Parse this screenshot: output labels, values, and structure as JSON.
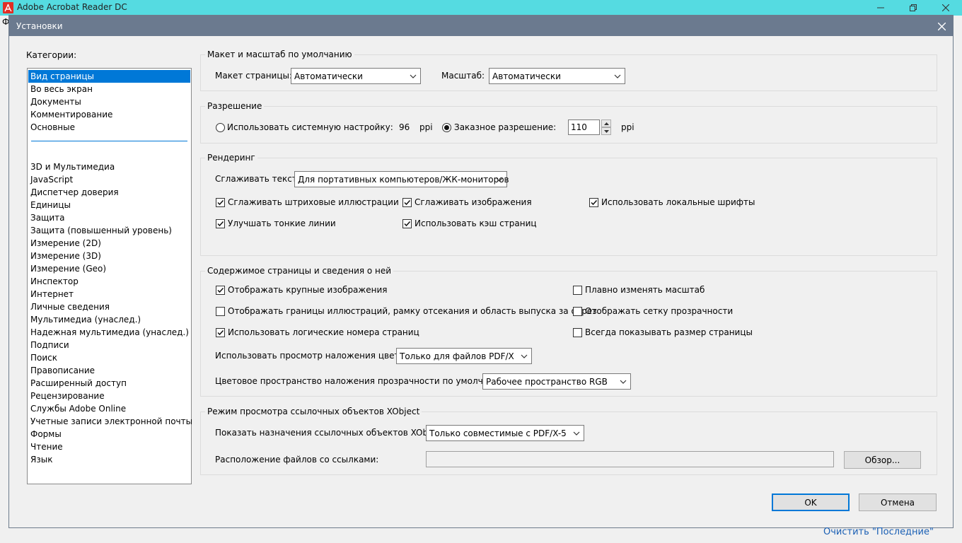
{
  "app": {
    "title": "Adobe Acrobat Reader DC",
    "menu_fragment": "Ф"
  },
  "dialog": {
    "title": "Установки",
    "close_glyph": "✕"
  },
  "categories": {
    "label": "Категории:",
    "selected": "Вид страницы",
    "top_items": [
      "Вид страницы",
      "Во весь экран",
      "Документы",
      "Комментирование",
      "Основные"
    ],
    "items": [
      "3D и Мультимедиа",
      "JavaScript",
      "Диспетчер доверия",
      "Единицы",
      "Защита",
      "Защита (повышенный уровень)",
      "Измерение (2D)",
      "Измерение (3D)",
      "Измерение (Geo)",
      "Инспектор",
      "Интернет",
      "Личные сведения",
      "Мультимедиа (унаслед.)",
      "Надежная мультимедиа (унаслед.)",
      "Подписи",
      "Поиск",
      "Правописание",
      "Расширенный доступ",
      "Рецензирование",
      "Службы Adobe Online",
      "Учетные записи электронной почты",
      "Формы",
      "Чтение",
      "Язык"
    ]
  },
  "layout_group": {
    "title": "Макет и масштаб по умолчанию",
    "page_layout_label": "Макет страницы:",
    "page_layout_value": "Автоматически",
    "zoom_label": "Масштаб:",
    "zoom_value": "Автоматически"
  },
  "resolution_group": {
    "title": "Разрешение",
    "system_label": "Использовать системную настройку:",
    "system_value": "96",
    "system_unit": "ppi",
    "custom_label": "Заказное разрешение:",
    "custom_value": "110",
    "custom_unit": "ppi",
    "selected": "custom"
  },
  "rendering_group": {
    "title": "Рендеринг",
    "smooth_text_label": "Сглаживать текст:",
    "smooth_text_value": "Для портативных компьютеров/ЖК-мониторов",
    "checks": [
      {
        "label": "Сглаживать штриховые иллюстрации",
        "checked": true
      },
      {
        "label": "Сглаживать изображения",
        "checked": true
      },
      {
        "label": "Использовать локальные шрифты",
        "checked": true
      },
      {
        "label": "Улучшать тонкие линии",
        "checked": true
      },
      {
        "label": "Использовать кэш страниц",
        "checked": true
      }
    ]
  },
  "content_group": {
    "title": "Содержимое страницы и сведения о ней",
    "checks": [
      {
        "label": "Отображать крупные изображения",
        "checked": true
      },
      {
        "label": "Отображать границы иллюстраций, рамку отсекания и область выпуска за обрез",
        "checked": false
      },
      {
        "label": "Использовать логические номера страниц",
        "checked": true
      },
      {
        "label": "Плавно изменять масштаб",
        "checked": false
      },
      {
        "label": "Отображать сетку прозрачности",
        "checked": false
      },
      {
        "label": "Всегда показывать размер страницы",
        "checked": false
      }
    ],
    "overprint_label": "Использовать просмотр наложения цветов:",
    "overprint_value": "Только для файлов PDF/X",
    "blend_label": "Цветовое пространство наложения прозрачности по умолчанию:",
    "blend_value": "Рабочее пространство RGB"
  },
  "xobject_group": {
    "title": "Режим просмотра ссылочных объектов XObject",
    "show_label": "Показать назначения ссылочных объектов XObject:",
    "show_value": "Только совместимые с PDF/X-5",
    "location_label": "Расположение файлов со ссылками:",
    "location_value": "",
    "browse_label": "Обзор..."
  },
  "buttons": {
    "ok": "OK",
    "cancel": "Отмена"
  },
  "footer_link": "Очистить \"Последние\"",
  "colors": {
    "app_titlebar": "#55dbe1",
    "dialog_titlebar": "#6b7a8f",
    "selection": "#0078d7"
  }
}
